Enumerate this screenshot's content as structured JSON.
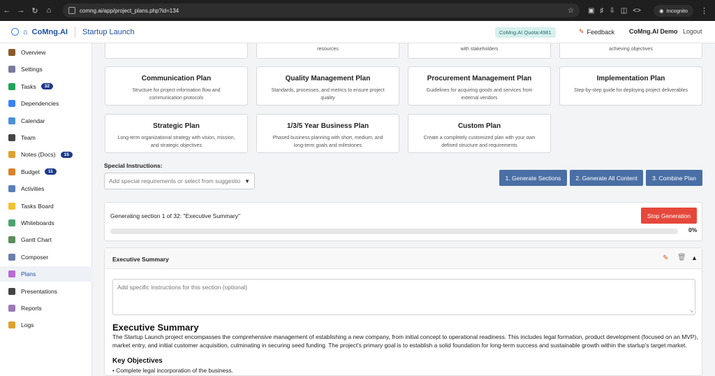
{
  "browser": {
    "url": "comng.ai/app/project_plans.php?id=134",
    "incognito_label": "Incognito"
  },
  "header": {
    "brand": "CoMng.AI",
    "project": "Startup Launch",
    "quota": "CoMng.AI Quota:4981",
    "feedback": "Feedback",
    "user": "CoMng.AI Demo",
    "logout": "Logout"
  },
  "sidebar": {
    "items": [
      {
        "label": "Overview",
        "icon": "briefcase-icon",
        "color": "#8b5a2b"
      },
      {
        "label": "Settings",
        "icon": "gear-icon",
        "color": "#7a7a9a"
      },
      {
        "label": "Tasks",
        "icon": "checkbox-icon",
        "color": "#22a35a",
        "badge": "32"
      },
      {
        "label": "Dependencies",
        "icon": "link-icon",
        "color": "#3b82f6"
      },
      {
        "label": "Calendar",
        "icon": "calendar-icon",
        "color": "#4a90d9"
      },
      {
        "label": "Team",
        "icon": "team-icon",
        "color": "#444"
      },
      {
        "label": "Notes (Docs)",
        "icon": "notes-icon",
        "color": "#e0a030",
        "badge": "15"
      },
      {
        "label": "Budget",
        "icon": "money-bag-icon",
        "color": "#d9822b",
        "badge": "11"
      },
      {
        "label": "Activities",
        "icon": "chart-icon",
        "color": "#5a7fb8"
      },
      {
        "label": "Tasks Board",
        "icon": "board-icon",
        "color": "#f2c230"
      },
      {
        "label": "Whiteboards",
        "icon": "whiteboard-icon",
        "color": "#4aa36e"
      },
      {
        "label": "Gantt Chart",
        "icon": "gantt-icon",
        "color": "#5b8c5a"
      },
      {
        "label": "Composer",
        "icon": "compose-icon",
        "color": "#6b7fa8"
      },
      {
        "label": "Plans",
        "icon": "clipboard-icon",
        "color": "#b86ad9",
        "active": true
      },
      {
        "label": "Presentations",
        "icon": "presentation-icon",
        "color": "#444"
      },
      {
        "label": "Reports",
        "icon": "report-icon",
        "color": "#9a7ab8"
      },
      {
        "label": "Logs",
        "icon": "logs-icon",
        "color": "#e0a030"
      }
    ]
  },
  "plan_cards_top_row": [
    {
      "desc": "resources"
    },
    {
      "desc": "with stakeholders"
    },
    {
      "desc": "achieving objectives"
    }
  ],
  "plan_cards": [
    {
      "title": "Communication Plan",
      "desc": "Structure for project information flow and communication protocols"
    },
    {
      "title": "Quality Management Plan",
      "desc": "Standards, processes, and metrics to ensure project quality"
    },
    {
      "title": "Procurement Management Plan",
      "desc": "Guidelines for acquiring goods and services from external vendors"
    },
    {
      "title": "Implementation Plan",
      "desc": "Step-by-step guide for deploying project deliverables"
    },
    {
      "title": "Strategic Plan",
      "desc": "Long-term organizational strategy with vision, mission, and strategic objectives"
    },
    {
      "title": "1/3/5 Year Business Plan",
      "desc": "Phased business planning with short, medium, and long-term goals and milestones"
    },
    {
      "title": "Custom Plan",
      "desc": "Create a completely customized plan with your own defined structure and requirements"
    }
  ],
  "special_instructions": {
    "label": "Special Instructions:",
    "placeholder": "Add special requirements or select from suggestio"
  },
  "actions": {
    "generate_sections": "1. Generate Sections",
    "generate_all": "2. Generate All Content",
    "combine": "3. Combine Plan"
  },
  "generation": {
    "status": "Generating section 1 of 32: \"Executive Summary\"",
    "stop_label": "Stop Generation",
    "progress": 0,
    "progress_label": "0%"
  },
  "section": {
    "title": "Executive Summary",
    "instructions_placeholder": "Add specific instructions for this section (optional)",
    "content_heading": "Executive Summary",
    "content_paragraph": "The Startup Launch project encompasses the comprehensive management of establishing a new company, from initial concept to operational readiness. This includes legal formation, product development (focused on an MVP), market entry, and initial customer acquisition, culminating in securing seed funding. The project's primary goal is to establish a solid foundation for long-term success and sustainable growth within the startup's target market.",
    "subheading": "Key Objectives",
    "bullet_1": "Complete legal incorporation of the business."
  }
}
